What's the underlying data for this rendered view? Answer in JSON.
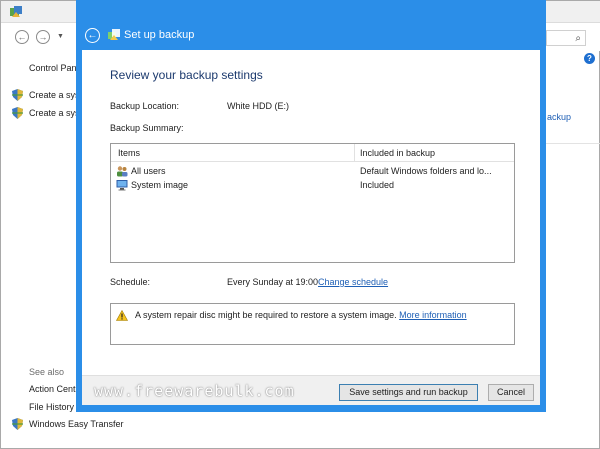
{
  "background": {
    "breadcrumb_fragment": "Control Pan",
    "tasks": [
      "Create a sys",
      "Create a sys"
    ],
    "right_link_fragment": "ackup",
    "see_also_label": "See also",
    "see_also_items": [
      "Action Cent",
      "File History",
      "Windows Easy Transfer"
    ]
  },
  "dialog": {
    "title": "Set up backup",
    "heading": "Review your backup settings",
    "location_label": "Backup Location:",
    "location_value": "White HDD (E:)",
    "summary_label": "Backup Summary:",
    "columns": [
      "Items",
      "Included in backup"
    ],
    "rows": [
      {
        "item": "All users",
        "included": "Default Windows folders and lo..."
      },
      {
        "item": "System image",
        "included": "Included"
      }
    ],
    "schedule_label": "Schedule:",
    "schedule_value": "Every Sunday at 19:00",
    "change_schedule_link": "Change schedule",
    "warning_text": "A system repair disc might be required to restore a system image.",
    "more_info_link": "More information",
    "watermark": "www.freewarebulk.com",
    "save_button": "Save settings and run backup",
    "cancel_button": "Cancel",
    "close_glyph": "✕"
  },
  "colors": {
    "accent": "#2b8ee8",
    "close": "#c9302c",
    "link": "#1e5fb5",
    "heading": "#1c3a6e"
  },
  "icons": [
    "back-arrow-icon",
    "backup-icon",
    "shield-icon",
    "users-icon",
    "computer-icon",
    "warning-icon",
    "search-icon",
    "help-icon"
  ]
}
